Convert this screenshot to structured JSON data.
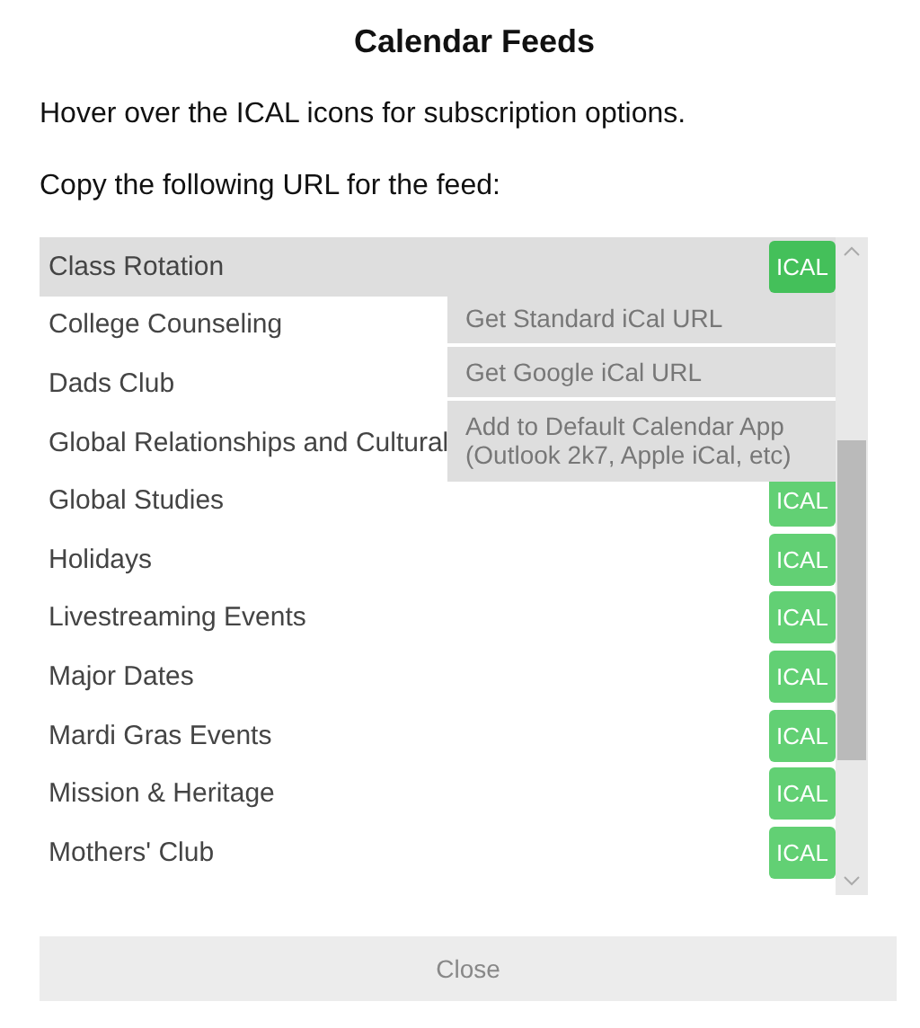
{
  "dialog": {
    "title": "Calendar Feeds",
    "instructions": [
      "Hover over the ICAL icons for subscription options.",
      "Copy the following URL for the feed:"
    ]
  },
  "feeds": [
    {
      "name": "Class Rotation",
      "badge": "ICAL",
      "selected": true
    },
    {
      "name": "College Counseling",
      "selected": false
    },
    {
      "name": "Dads Club",
      "selected": false
    },
    {
      "name": "Global Relationships and Cultural",
      "selected": false
    },
    {
      "name": "Global Studies",
      "badge": "ICAL",
      "selected": false
    },
    {
      "name": "Holidays",
      "badge": "ICAL",
      "selected": false
    },
    {
      "name": "Livestreaming Events",
      "badge": "ICAL",
      "selected": false
    },
    {
      "name": "Major Dates",
      "badge": "ICAL",
      "selected": false
    },
    {
      "name": "Mardi Gras Events",
      "badge": "ICAL",
      "selected": false
    },
    {
      "name": "Mission & Heritage",
      "badge": "ICAL",
      "selected": false
    },
    {
      "name": "Mothers' Club",
      "badge": "ICAL",
      "selected": false
    }
  ],
  "menu": [
    "Get Standard iCal URL",
    "Get Google iCal URL",
    "Add to Default Calendar App (Outlook 2k7, Apple iCal, etc)"
  ],
  "close_button": "Close"
}
